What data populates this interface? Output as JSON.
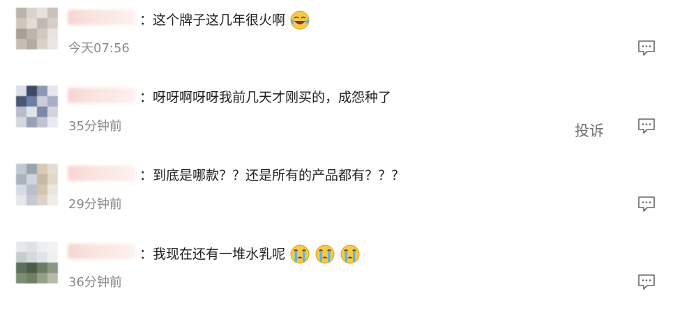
{
  "comments": [
    {
      "text": "：这个牌子这几年很火啊",
      "time": "今天07:56",
      "emojis": [
        "laugh-cry-emoji"
      ],
      "avatar_colors": [
        "#b9b3ac",
        "#d9d3cc",
        "#e6e1dc",
        "#c8c2bb",
        "#cfc7bd",
        "#e2dcd6",
        "#c1b9b0",
        "#d7cfc7",
        "#a89f97",
        "#bdb4ab",
        "#d2c9c0",
        "#e8e3de",
        "#c6beb6",
        "#b4aba2",
        "#d9d2cb",
        "#eae6e2"
      ]
    },
    {
      "text": "：呀呀啊呀呀我前几天才刚买的，成怨种了",
      "time": "35分钟前",
      "report": "投诉",
      "emojis": [],
      "avatar_colors": [
        "#dcdde6",
        "#3c4a6a",
        "#8d98b3",
        "#e6e7ee",
        "#4a5674",
        "#6e7fa6",
        "#c9cdd9",
        "#a6afc6",
        "#b9bccb",
        "#e1e3ea",
        "#7c88a8",
        "#d2d5df",
        "#d6d7de",
        "#9aa1b4",
        "#c0c4d1",
        "#e9eaef"
      ]
    },
    {
      "text": "：到底是哪款？？还是所有的产品都有？？？",
      "time": "29分钟前",
      "emojis": [],
      "avatar_colors": [
        "#c2c7d1",
        "#9aa3b0",
        "#d9c9b3",
        "#e4ddd2",
        "#aab2bf",
        "#cfd4dc",
        "#c7b9a2",
        "#e2d9cb",
        "#d7dbe2",
        "#b9bfcb",
        "#d3c6b1",
        "#ebe6dd",
        "#e5e7eb",
        "#c4c9d2",
        "#dcd3c5",
        "#f0ede8"
      ]
    },
    {
      "text": "：我现在还有一堆水乳呢",
      "time": "36分钟前",
      "emojis": [
        "crying-emoji",
        "crying-emoji",
        "crying-emoji"
      ],
      "avatar_colors": [
        "#e6e8ea",
        "#dfe2e5",
        "#eceeef",
        "#f2f3f4",
        "#c6ccd0",
        "#d5d9dc",
        "#e1e4e6",
        "#eef0f1",
        "#5c6f5a",
        "#4a5d4b",
        "#6b7c66",
        "#8a9785",
        "#7d8c74",
        "#6f7f62",
        "#95a08a",
        "#b4bca9"
      ]
    }
  ]
}
